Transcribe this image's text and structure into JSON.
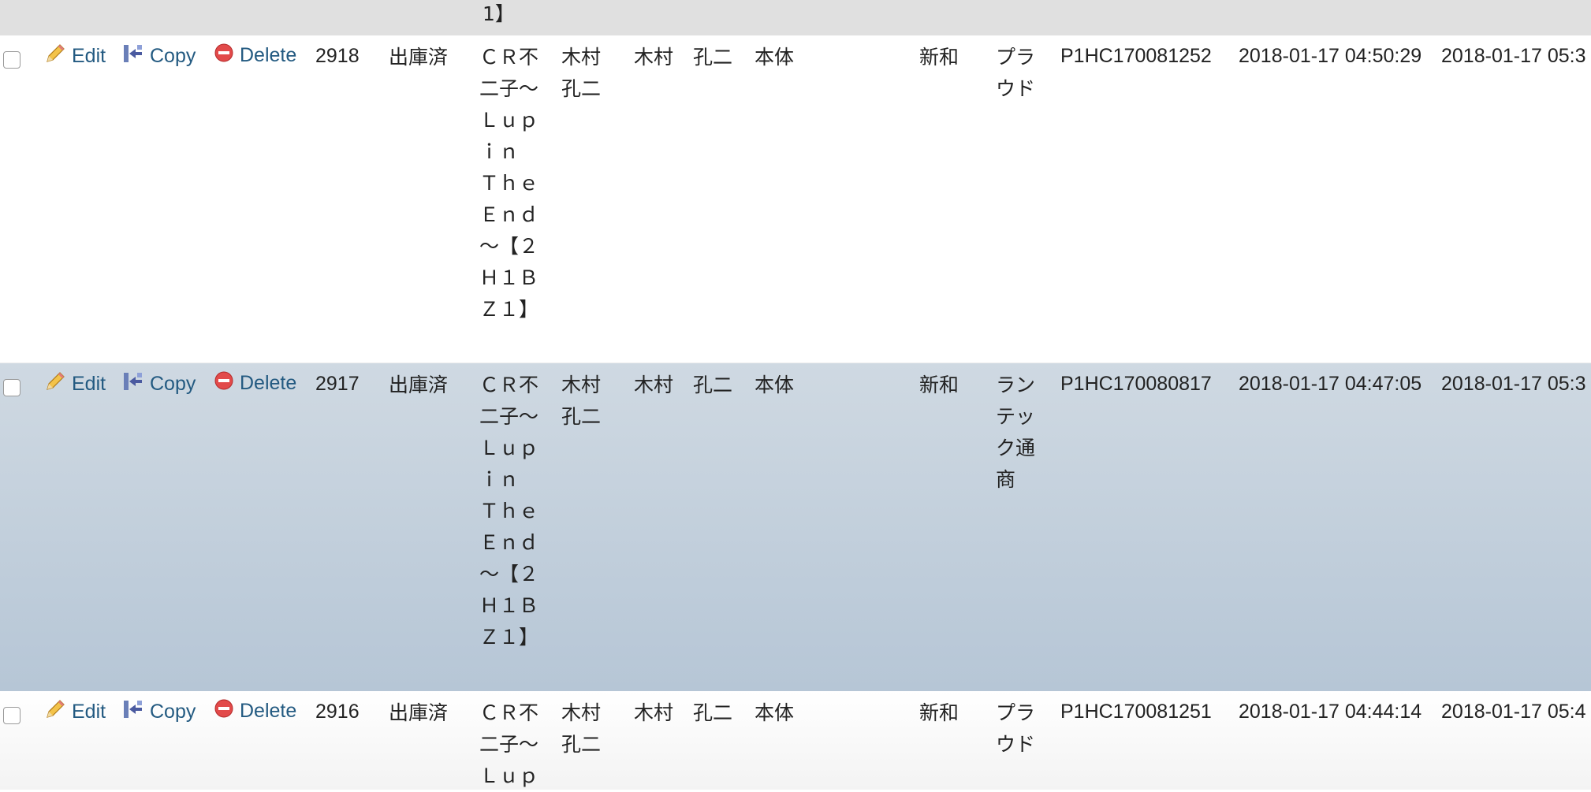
{
  "top_partial": {
    "name_tail": "1】"
  },
  "actions": {
    "edit": "Edit",
    "copy": "Copy",
    "delete": "Delete"
  },
  "rows": [
    {
      "id": "2918",
      "status": "出庫済",
      "product": "ＣＲ不二子～Ｌｕｐｉｎ Ｔｈｅ Ｅｎｄ～【２Ｈ１ＢＺ１】",
      "person1": "木村　孔二",
      "person2": "木村　孔二",
      "part": "本体",
      "maker": "新和",
      "dealer": "プラウド",
      "serial": "P1HC170081252",
      "created": "2018-01-17 04:50:29",
      "updated": "2018-01-17 05:3"
    },
    {
      "id": "2917",
      "status": "出庫済",
      "product": "ＣＲ不二子～Ｌｕｐｉｎ Ｔｈｅ Ｅｎｄ～【２Ｈ１ＢＺ１】",
      "person1": "木村　孔二",
      "person2": "木村　孔二",
      "part": "本体",
      "maker": "新和",
      "dealer": "ランテック通商",
      "serial": "P1HC170080817",
      "created": "2018-01-17 04:47:05",
      "updated": "2018-01-17 05:3"
    },
    {
      "id": "2916",
      "status": "出庫済",
      "product": "ＣＲ不二子～Ｌｕｐ",
      "person1": "木村　孔二",
      "person2": "木村　孔二",
      "part": "本体",
      "maker": "新和",
      "dealer": "プラウド",
      "serial": "P1HC170081251",
      "created": "2018-01-17 04:44:14",
      "updated": "2018-01-17 05:4"
    }
  ]
}
